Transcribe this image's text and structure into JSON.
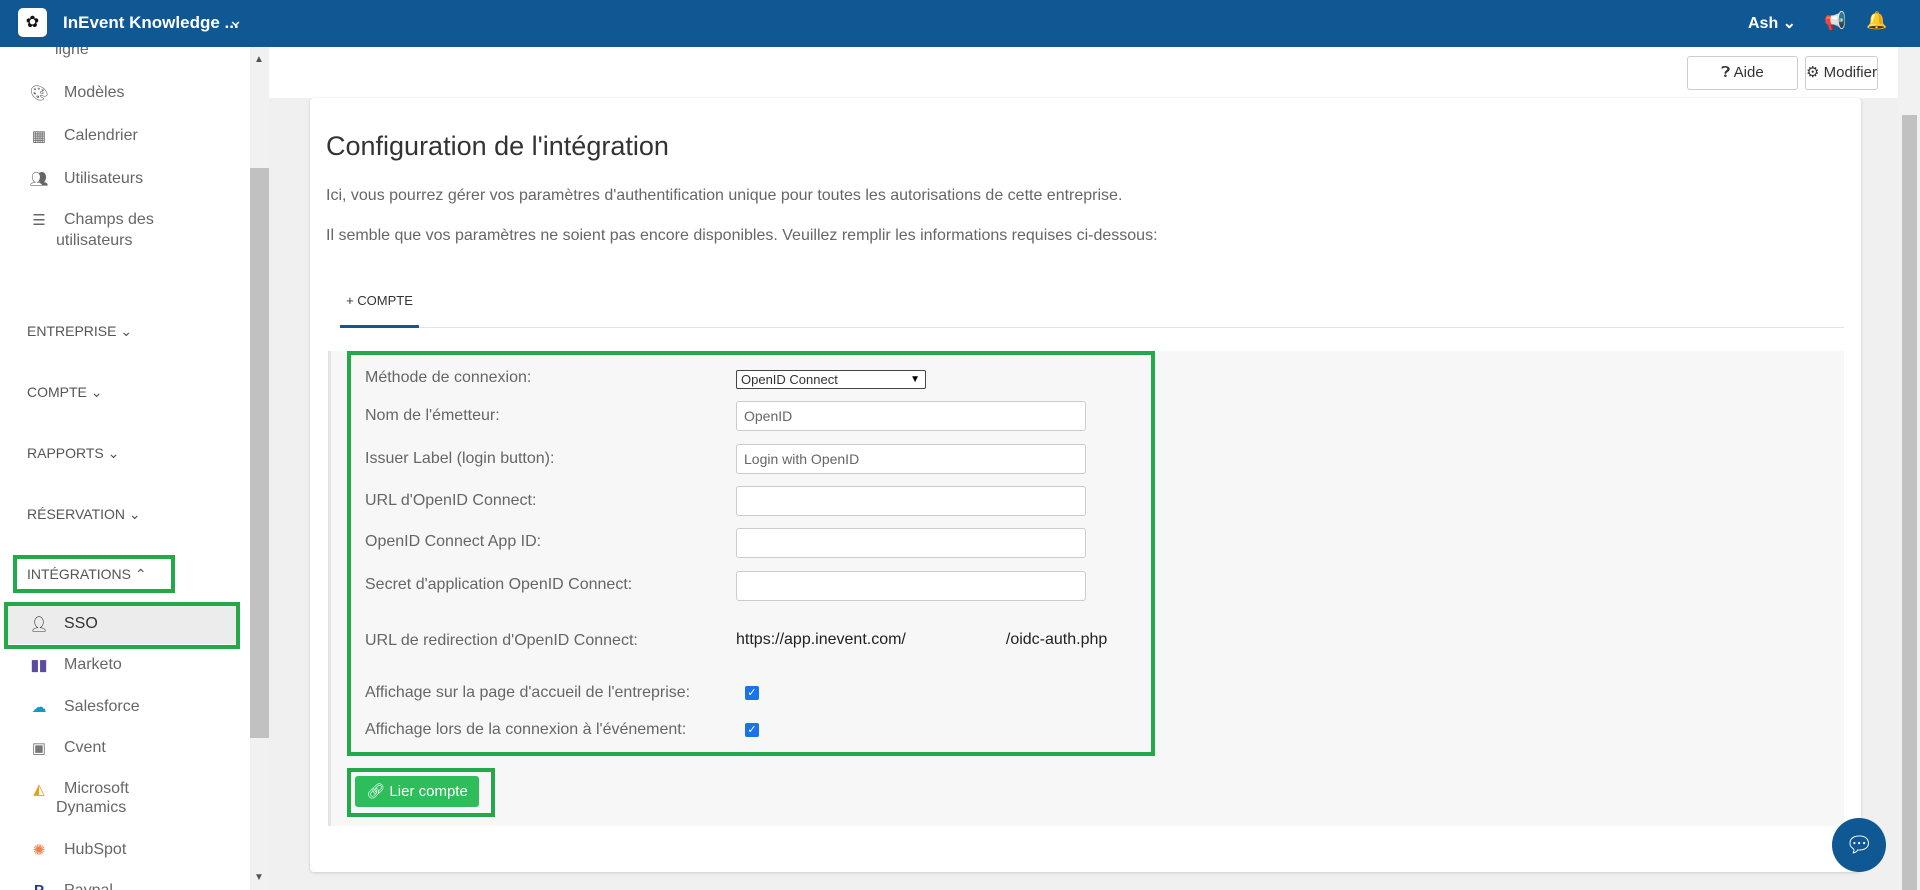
{
  "topbar": {
    "brand": "InEvent Knowledge ...",
    "user": "Ash",
    "colors": {
      "bar": "#0f5894"
    }
  },
  "sidebar": {
    "items_top": [
      {
        "label": "ligne"
      },
      {
        "label": "Modèles",
        "icon": "palette-icon"
      },
      {
        "label": "Calendrier",
        "icon": "calendar-icon"
      },
      {
        "label": "Utilisateurs",
        "icon": "users-icon"
      },
      {
        "label": "Champs des",
        "label2": "utilisateurs",
        "icon": "list-icon"
      }
    ],
    "sections": [
      "ENTREPRISE",
      "COMPTE",
      "RAPPORTS",
      "RÉSERVATION",
      "INTÉGRATIONS"
    ],
    "integrations": [
      {
        "label": "SSO",
        "icon": "user-lock-icon"
      },
      {
        "label": "Marketo",
        "icon": "marketo-icon"
      },
      {
        "label": "Salesforce",
        "icon": "salesforce-icon"
      },
      {
        "label": "Cvent",
        "icon": "cvent-icon"
      },
      {
        "label": "Microsoft",
        "label2": "Dynamics",
        "icon": "microsoft-dynamics-icon"
      },
      {
        "label": "HubSpot",
        "icon": "hubspot-icon"
      },
      {
        "label": "Paypal",
        "icon": "paypal-icon"
      }
    ]
  },
  "actions": {
    "help": "Aide",
    "edit": "Modifier"
  },
  "main": {
    "title": "Configuration de l'intégration",
    "desc1": "Ici, vous pourrez gérer vos paramètres d'authentification unique pour toutes les autorisations de cette entreprise.",
    "desc2": "Il semble que vos paramètres ne soient pas encore disponibles. Veuillez remplir les informations requises ci-dessous:",
    "tab": "+ COMPTE",
    "form": {
      "method_label": "Méthode de connexion:",
      "method_value": "OpenID Connect",
      "issuer_label": "Nom de l'émetteur:",
      "issuer_value": "OpenID",
      "issuer_btn_label": "Issuer Label (login button):",
      "issuer_btn_value": "Login with OpenID",
      "url_label": "URL d'OpenID Connect:",
      "appid_label": "OpenID Connect App ID:",
      "secret_label": "Secret d'application OpenID Connect:",
      "redirect_label": "URL de redirection d'OpenID Connect:",
      "redirect_prefix": "https://app.inevent.com/",
      "redirect_suffix": "/oidc-auth.php",
      "home_label": "Affichage sur la page d'accueil de l'entreprise:",
      "home_checked": true,
      "event_label": "Affichage lors de la connexion à l'événement:",
      "event_checked": true
    },
    "link_button": "Lier compte"
  },
  "colors": {
    "highlight": "#23a84a",
    "button": "#2dbd5b"
  }
}
